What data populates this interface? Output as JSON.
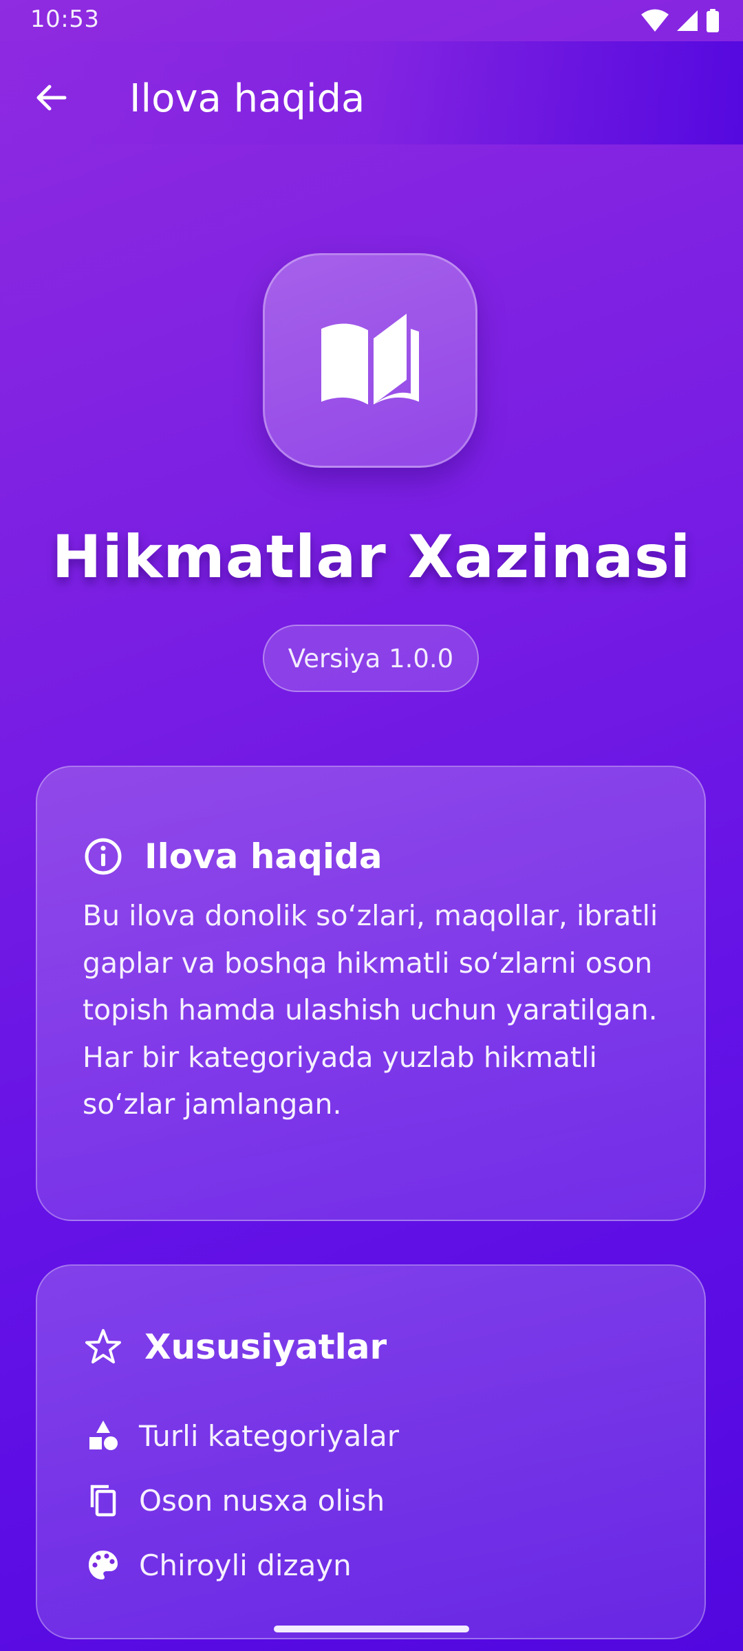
{
  "status_bar": {
    "time": "10:53",
    "icons": [
      "wifi-icon",
      "signal-icon",
      "battery-icon"
    ]
  },
  "app_bar": {
    "back_icon": "arrow-left-icon",
    "title": "Ilova haqida"
  },
  "header": {
    "logo_icon": "open-book-icon",
    "app_name": "Hikmatlar Xazinasi",
    "version": "Versiya 1.0.0"
  },
  "about_card": {
    "icon": "info-icon",
    "title": "Ilova haqida",
    "text": "Bu ilova donolik so‘zlari, maqollar, ibratli gaplar va boshqa hikmatli so‘zlarni oson topish hamda ulashish uchun yaratilgan. Har bir kategoriyada yuzlab hikmatli so‘zlar jamlangan."
  },
  "features_card": {
    "icon": "star-outline-icon",
    "title": "Xususiyatlar",
    "items": [
      {
        "icon": "category-shapes-icon",
        "label": "Turli kategoriyalar"
      },
      {
        "icon": "copy-icon",
        "label": "Oson nusxa olish"
      },
      {
        "icon": "palette-icon",
        "label": "Chiroyli dizayn"
      }
    ]
  },
  "colors": {
    "gradient_start": "#8f2be0",
    "gradient_end": "#5207e0",
    "text": "#ffffff"
  }
}
